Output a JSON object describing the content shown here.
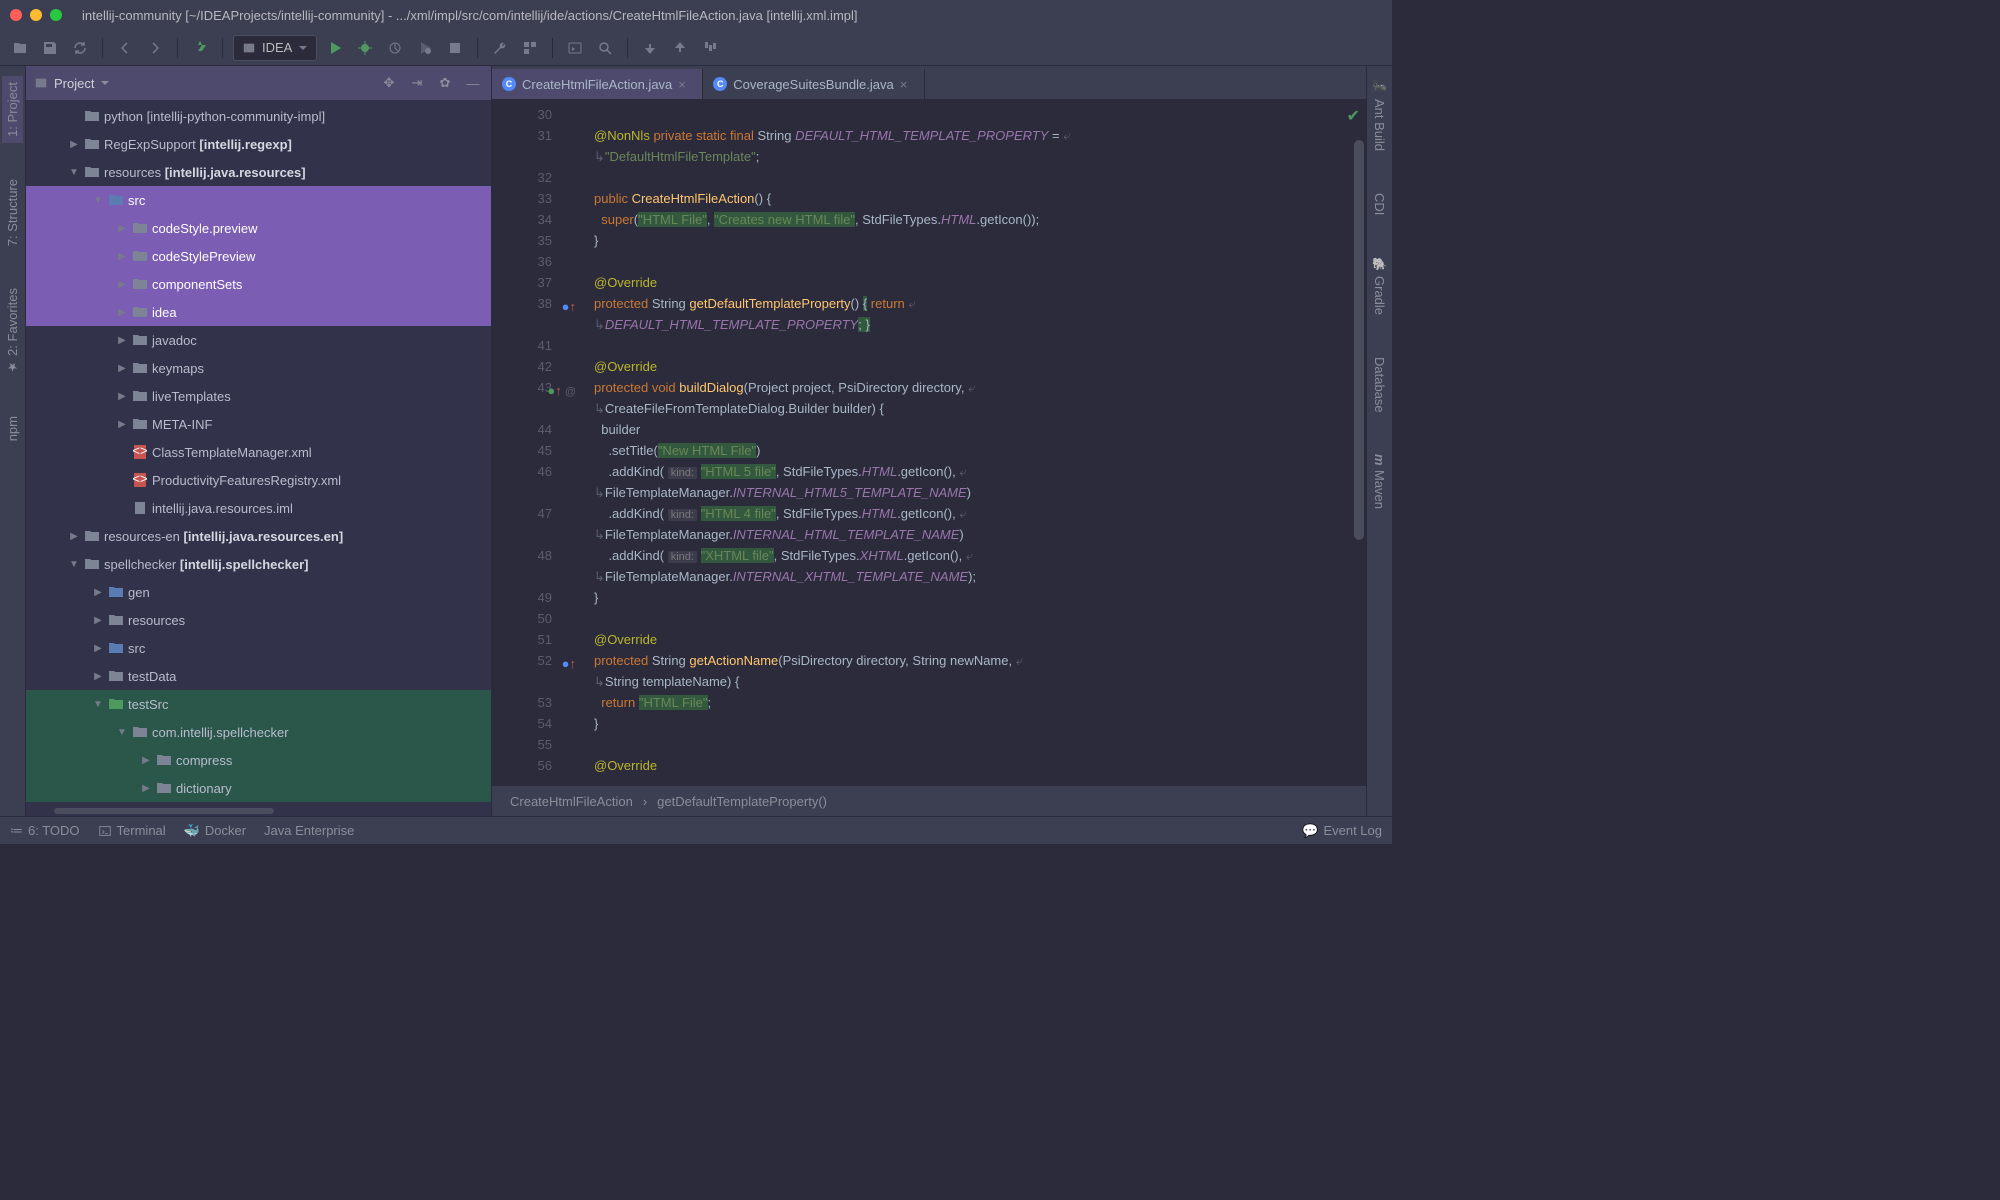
{
  "window": {
    "title": "intellij-community [~/IDEAProjects/intellij-community] - .../xml/impl/src/com/intellij/ide/actions/CreateHtmlFileAction.java [intellij.xml.impl]"
  },
  "config": {
    "label": "IDEA"
  },
  "project": {
    "title": "Project"
  },
  "tree": [
    {
      "d": 1,
      "arr": "",
      "icon": "folder",
      "label": "python [intellij-python-community-impl]",
      "cls": ""
    },
    {
      "d": 1,
      "arr": "▶",
      "icon": "folder",
      "label": "RegExpSupport",
      "suffix": " [intellij.regexp]",
      "cls": ""
    },
    {
      "d": 1,
      "arr": "▼",
      "icon": "folder",
      "label": "resources",
      "suffix": " [intellij.java.resources]",
      "cls": ""
    },
    {
      "d": 2,
      "arr": "▼",
      "icon": "folder-blue",
      "label": "src",
      "cls": "sel-purple"
    },
    {
      "d": 3,
      "arr": "▶",
      "icon": "folder",
      "label": "codeStyle.preview",
      "cls": "sel-purple"
    },
    {
      "d": 3,
      "arr": "▶",
      "icon": "folder",
      "label": "codeStylePreview",
      "cls": "sel-purple"
    },
    {
      "d": 3,
      "arr": "▶",
      "icon": "folder",
      "label": "componentSets",
      "cls": "sel-purple"
    },
    {
      "d": 3,
      "arr": "▶",
      "icon": "folder",
      "label": "idea",
      "cls": "sel-purple"
    },
    {
      "d": 3,
      "arr": "▶",
      "icon": "folder",
      "label": "javadoc",
      "cls": ""
    },
    {
      "d": 3,
      "arr": "▶",
      "icon": "folder",
      "label": "keymaps",
      "cls": ""
    },
    {
      "d": 3,
      "arr": "▶",
      "icon": "folder",
      "label": "liveTemplates",
      "cls": ""
    },
    {
      "d": 3,
      "arr": "▶",
      "icon": "folder",
      "label": "META-INF",
      "cls": ""
    },
    {
      "d": 3,
      "arr": "",
      "icon": "xml",
      "label": "ClassTemplateManager.xml",
      "cls": ""
    },
    {
      "d": 3,
      "arr": "",
      "icon": "xml",
      "label": "ProductivityFeaturesRegistry.xml",
      "cls": ""
    },
    {
      "d": 3,
      "arr": "",
      "icon": "iml",
      "label": "intellij.java.resources.iml",
      "cls": ""
    },
    {
      "d": 1,
      "arr": "▶",
      "icon": "folder",
      "label": "resources-en",
      "suffix": " [intellij.java.resources.en]",
      "cls": ""
    },
    {
      "d": 1,
      "arr": "▼",
      "icon": "folder",
      "label": "spellchecker",
      "suffix": " [intellij.spellchecker]",
      "cls": ""
    },
    {
      "d": 2,
      "arr": "▶",
      "icon": "folder-blue",
      "label": "gen",
      "cls": ""
    },
    {
      "d": 2,
      "arr": "▶",
      "icon": "folder",
      "label": "resources",
      "cls": ""
    },
    {
      "d": 2,
      "arr": "▶",
      "icon": "folder-blue",
      "label": "src",
      "cls": ""
    },
    {
      "d": 2,
      "arr": "▶",
      "icon": "folder",
      "label": "testData",
      "cls": ""
    },
    {
      "d": 2,
      "arr": "▼",
      "icon": "folder-green",
      "label": "testSrc",
      "cls": "sel-green"
    },
    {
      "d": 3,
      "arr": "▼",
      "icon": "folder",
      "label": "com.intellij.spellchecker",
      "cls": "sel-green"
    },
    {
      "d": 4,
      "arr": "▶",
      "icon": "folder",
      "label": "compress",
      "cls": "sel-green"
    },
    {
      "d": 4,
      "arr": "▶",
      "icon": "folder",
      "label": "dictionary",
      "cls": "sel-green"
    }
  ],
  "tabs": [
    {
      "label": "CreateHtmlFileAction.java",
      "active": true
    },
    {
      "label": "CoverageSuitesBundle.java",
      "active": false
    }
  ],
  "leftTabs": [
    "1: Project",
    "7: Structure",
    "2: Favorites",
    "npm"
  ],
  "rightTabs": [
    "Ant Build",
    "CDI",
    "Gradle",
    "Database",
    "Maven"
  ],
  "gutterLines": [
    "30",
    "31",
    "",
    "32",
    "33",
    "34",
    "35",
    "36",
    "37",
    "38",
    "",
    "41",
    "42",
    "43",
    "",
    "44",
    "45",
    "46",
    "",
    "47",
    "",
    "48",
    "",
    "49",
    "50",
    "51",
    "52",
    "",
    "53",
    "54",
    "55",
    "56"
  ],
  "breadcrumb": {
    "a": "CreateHtmlFileAction",
    "b": "getDefaultTemplateProperty()"
  },
  "status": {
    "todo": "6: TODO",
    "terminal": "Terminal",
    "docker": "Docker",
    "je": "Java Enterprise",
    "eventlog": "Event Log"
  }
}
